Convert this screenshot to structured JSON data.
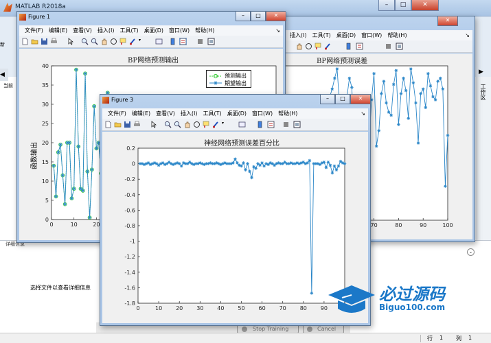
{
  "app": {
    "title": "MATLAB R2018a",
    "side_tab": "工作区",
    "left_tab_partial": "当前",
    "left_tab_partial2": "新"
  },
  "details": {
    "header": "详细信息",
    "hint": "选择文件以查看详细信息"
  },
  "status": {
    "row_label": "行",
    "row_value": "1",
    "col_label": "列",
    "col_value": "1"
  },
  "training_buttons": {
    "stop": "Stop Training",
    "cancel": "Cancel"
  },
  "watermark": {
    "cn": "必过源码",
    "en": "Biguo100.com"
  },
  "figure1": {
    "title": "Figure 1",
    "menu": [
      "文件(F)",
      "编辑(E)",
      "查看(V)",
      "插入(I)",
      "工具(T)",
      "桌面(D)",
      "窗口(W)",
      "帮助(H)"
    ],
    "menu_arrow": "↘",
    "chart_title": "BP网络预测输出",
    "ylabel": "函数输出",
    "legend": [
      "预测输出",
      "期望输出"
    ]
  },
  "figure2": {
    "menu": [
      "插入(I)",
      "工具(T)",
      "桌面(D)",
      "窗口(W)",
      "帮助(H)"
    ],
    "menu_arrow": "↘",
    "chart_title": "BP网络预测误差"
  },
  "figure3": {
    "title": "Figure 3",
    "menu": [
      "文件(F)",
      "编辑(E)",
      "查看(V)",
      "插入(I)",
      "工具(T)",
      "桌面(D)",
      "窗口(W)",
      "帮助(H)"
    ],
    "menu_arrow": "↘",
    "chart_title": "神经网络预测误差百分比"
  },
  "chart_data": [
    {
      "type": "line",
      "title": "BP网络预测输出",
      "ylabel": "函数输出",
      "xlim": [
        0,
        100
      ],
      "ylim": [
        0,
        40
      ],
      "yticks": [
        0,
        5,
        10,
        15,
        20,
        25,
        30,
        35,
        40
      ],
      "xticks": [
        0,
        10,
        20
      ],
      "series": [
        {
          "name": "预测输出",
          "marker": "circle",
          "color": "#33cc33",
          "x": [
            1,
            2,
            3,
            4,
            5,
            6,
            7,
            8,
            9,
            10,
            11,
            12,
            13,
            14,
            15,
            16,
            17,
            18,
            19,
            20,
            21,
            22,
            23,
            24,
            25
          ],
          "y": [
            14,
            6,
            17.5,
            19.5,
            11.5,
            4,
            20,
            20,
            5.5,
            8,
            39,
            19,
            8,
            7.5,
            38,
            12.5,
            0.5,
            13,
            29.5,
            18.5,
            20,
            12,
            4.5,
            8,
            33
          ]
        },
        {
          "name": "期望输出",
          "marker": "asterisk",
          "color": "#2a86c8",
          "x": [
            1,
            2,
            3,
            4,
            5,
            6,
            7,
            8,
            9,
            10,
            11,
            12,
            13,
            14,
            15,
            16,
            17,
            18,
            19,
            20,
            21,
            22,
            23,
            24,
            25
          ],
          "y": [
            14,
            6,
            17.5,
            19.5,
            11.5,
            4,
            20,
            20,
            5.5,
            8,
            39,
            19,
            8,
            7.5,
            38,
            12.5,
            0.5,
            13,
            29.5,
            18.5,
            20,
            12,
            4.5,
            8,
            33
          ]
        }
      ]
    },
    {
      "type": "line",
      "title": "BP网络预测误差",
      "xlim": [
        0,
        100
      ],
      "xticks": [
        70,
        80,
        90,
        100
      ],
      "series": [
        {
          "name": "",
          "marker": "asterisk",
          "color": "#2a86c8",
          "x": [
            52,
            53,
            54,
            55,
            56,
            57,
            58,
            59,
            60,
            61,
            62,
            63,
            64,
            65,
            66,
            67,
            68,
            69,
            70,
            71,
            72,
            73,
            74,
            75,
            76,
            77,
            78,
            79,
            80,
            81,
            82,
            83,
            84,
            85,
            86,
            87,
            88,
            89,
            90,
            91,
            92,
            93,
            94,
            95,
            96,
            97,
            98,
            99,
            100
          ],
          "y": [
            0.8,
            0.85,
            0.92,
            0.98,
            0.75,
            0.7,
            0.66,
            0.8,
            0.92,
            0.86,
            0.4,
            0.7,
            0.55,
            0.8,
            0.72,
            0.6,
            0.5,
            0.78,
            0.95,
            0.48,
            0.58,
            0.82,
            0.9,
            0.76,
            0.7,
            0.68,
            0.88,
            0.97,
            0.62,
            0.82,
            0.92,
            0.84,
            0.66,
            0.98,
            0.89,
            0.76,
            0.5,
            0.82,
            0.85,
            0.73,
            0.95,
            0.87,
            0.8,
            0.78,
            0.9,
            0.92,
            0.85,
            0.22,
            0.55
          ]
        }
      ]
    },
    {
      "type": "line",
      "title": "神经网络预测误差百分比",
      "xlim": [
        0,
        100
      ],
      "ylim": [
        -1.8,
        0.2
      ],
      "xticks": [
        0,
        10,
        20,
        30,
        40,
        50,
        60,
        70,
        80,
        90,
        100
      ],
      "yticks": [
        0.2,
        0,
        -0.2,
        -0.4,
        -0.6,
        -0.8,
        -1,
        -1.2,
        -1.4,
        -1.6,
        -1.8
      ],
      "series": [
        {
          "name": "",
          "marker": "asterisk",
          "color": "#2a86c8",
          "x": [
            1,
            2,
            3,
            4,
            5,
            6,
            7,
            8,
            9,
            10,
            11,
            12,
            13,
            14,
            15,
            16,
            17,
            18,
            19,
            20,
            21,
            22,
            23,
            24,
            25,
            26,
            27,
            28,
            29,
            30,
            31,
            32,
            33,
            34,
            35,
            36,
            37,
            38,
            39,
            40,
            41,
            42,
            43,
            44,
            45,
            46,
            47,
            48,
            49,
            50,
            51,
            52,
            53,
            54,
            55,
            56,
            57,
            58,
            59,
            60,
            61,
            62,
            63,
            64,
            65,
            66,
            67,
            68,
            69,
            70,
            71,
            72,
            73,
            74,
            75,
            76,
            77,
            78,
            79,
            80,
            81,
            82,
            83,
            84,
            85,
            86,
            87,
            88,
            89,
            90,
            91,
            92,
            93,
            94,
            95,
            96,
            97,
            98,
            99,
            100
          ],
          "y": [
            0,
            0,
            -0.01,
            0,
            0.01,
            -0.01,
            0,
            0.01,
            0,
            -0.02,
            0,
            0.01,
            -0.01,
            0,
            0.02,
            0,
            -0.01,
            0,
            0.01,
            0,
            -0.03,
            0.01,
            0,
            0,
            0.02,
            0,
            -0.01,
            0,
            0,
            0.01,
            0,
            -0.01,
            0,
            0,
            0.01,
            0,
            0,
            0.01,
            0,
            -0.01,
            0,
            0.01,
            0,
            0,
            0,
            0.01,
            0.06,
            0.01,
            -0.02,
            -0.03,
            0.01,
            -0.08,
            0,
            -0.1,
            -0.18,
            -0.04,
            -0.06,
            0,
            -0.02,
            0.01,
            -0.03,
            0,
            -0.01,
            0.01,
            0,
            -0.02,
            0,
            0.01,
            0,
            0,
            0.02,
            0,
            0,
            0.01,
            0,
            0,
            0.01,
            0,
            0.01,
            0.02,
            0,
            0.01,
            0.04,
            -1.67,
            0,
            0,
            0,
            -0.01,
            0.01,
            0.02,
            -0.05,
            0.02,
            -0.02,
            -0.12,
            -0.03,
            -0.08,
            -0.03,
            0.03,
            0.01,
            0
          ]
        }
      ]
    }
  ]
}
